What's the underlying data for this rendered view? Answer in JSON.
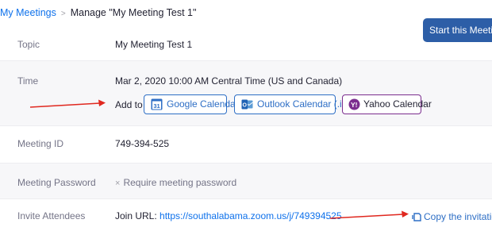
{
  "breadcrumb": {
    "parent": "My Meetings",
    "separator": ">",
    "current": "Manage \"My Meeting Test 1\""
  },
  "actions": {
    "start_label": "Start this Meeting"
  },
  "rows": {
    "topic": {
      "label": "Topic",
      "value": "My Meeting Test 1"
    },
    "time": {
      "label": "Time",
      "value": "Mar 2, 2020 10:00 AM Central Time (US and Canada)",
      "add_to": "Add to",
      "google_icon_text": "31",
      "google_label": "Google Calendar",
      "outlook_label": "Outlook Calendar (.ics)",
      "yahoo_label": "Yahoo Calendar"
    },
    "meeting_id": {
      "label": "Meeting ID",
      "value": "749-394-525"
    },
    "password": {
      "label": "Meeting Password",
      "value": "Require meeting password",
      "mark": "×"
    },
    "invite": {
      "label": "Invite Attendees",
      "join_prefix": "Join URL: ",
      "join_url": "https://southalabama.zoom.us/j/749394525",
      "copy_label": "Copy the invitation"
    }
  },
  "icons": {
    "google": "google-calendar-icon",
    "outlook": "outlook-calendar-icon",
    "yahoo": "yahoo-calendar-icon",
    "copy": "copy-icon",
    "arrows": "red-arrow-annotation"
  },
  "colors": {
    "link": "#0e71eb",
    "primary_button": "#2d5ea7",
    "calendar_border": "#2d6ec5",
    "yahoo_border": "#7b2d8e",
    "annotation_arrow": "#e0281f"
  }
}
